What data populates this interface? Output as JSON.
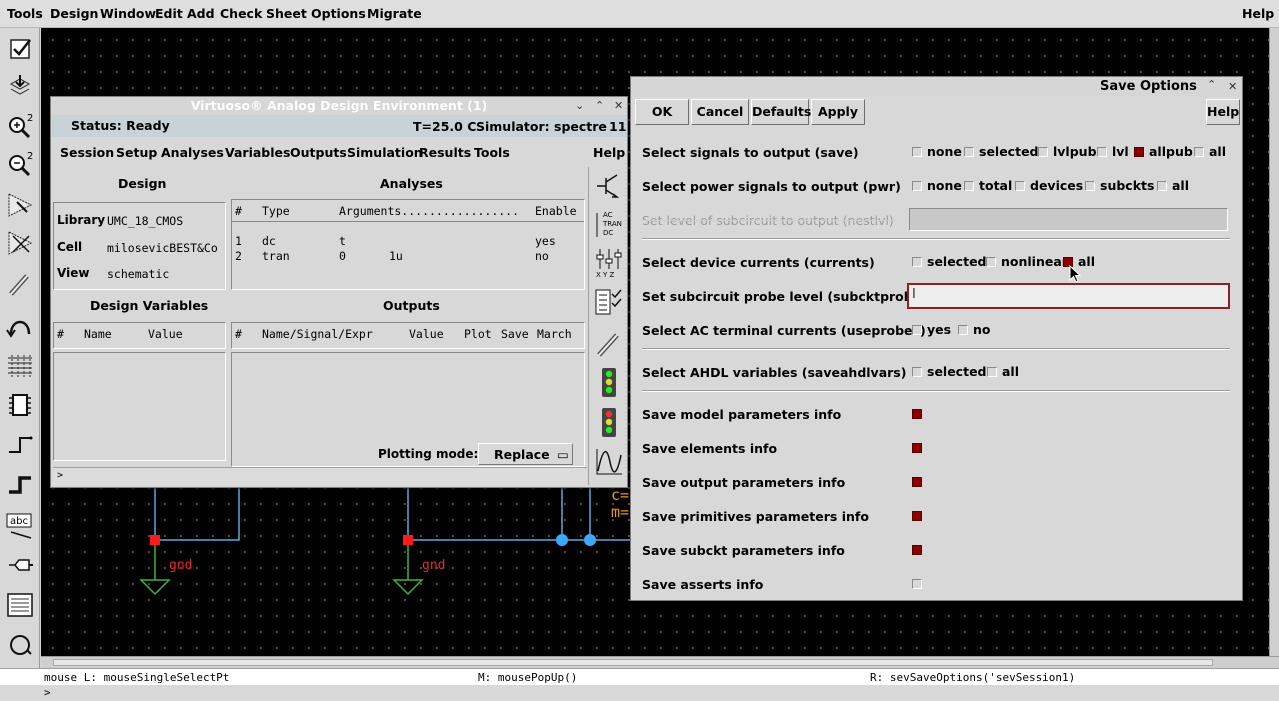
{
  "menubar": {
    "items": [
      "Tools",
      "Design",
      "Window",
      "Edit",
      "Add",
      "Check",
      "Sheet",
      "Options",
      "Migrate"
    ],
    "help": "Help"
  },
  "toolbar_icons": [
    "check-and-save-icon",
    "save-icon",
    "zoom-in-icon",
    "zoom-out-icon",
    "stretch-icon",
    "copy-icon",
    "delete-icon",
    "undo-icon",
    "property-icon",
    "instance-icon",
    "wire-narrow-icon",
    "wire-wide-icon",
    "label-icon",
    "pin-icon",
    "cmd-options-icon",
    "repeat-icon"
  ],
  "toolbar_label_abc": "abc",
  "schematic": {
    "gnd_label": "gnd",
    "partial_text_1": "c=",
    "partial_text_2": "m="
  },
  "ade": {
    "title": "Virtuoso® Analog Design Environment (1)",
    "status": "Status: Ready",
    "temperature": "T=25.0 C",
    "simulator": "Simulator: spectre",
    "counter": "11",
    "menus": [
      "Session",
      "Setup",
      "Analyses",
      "Variables",
      "Outputs",
      "Simulation",
      "Results",
      "Tools"
    ],
    "help": "Help",
    "design": {
      "heading": "Design",
      "library_label": "Library",
      "library_value": "UMC_18_CMOS",
      "cell_label": "Cell",
      "cell_value": "milosevicBEST&Co",
      "view_label": "View",
      "view_value": "schematic"
    },
    "analyses": {
      "heading": "Analyses",
      "columns": [
        "#",
        "Type",
        "Arguments.................",
        "Enable"
      ],
      "rows": [
        {
          "num": "1",
          "type": "dc",
          "arg1": "t",
          "arg2": "",
          "enable": "yes"
        },
        {
          "num": "2",
          "type": "tran",
          "arg1": "0",
          "arg2": "1u",
          "enable": "no"
        }
      ]
    },
    "design_variables": {
      "heading": "Design Variables",
      "columns": [
        "#",
        "Name",
        "Value"
      ]
    },
    "outputs": {
      "heading": "Outputs",
      "columns": [
        "#",
        "Name/Signal/Expr",
        "Value",
        "Plot",
        "Save",
        "March"
      ]
    },
    "plotting_mode_label": "Plotting mode:",
    "plotting_mode_value": "Replace",
    "prompt": ">",
    "side_tool_labels": {
      "ac": "AC",
      "tran": "TRAN",
      "dc": "DC",
      "xyz": "X Y Z"
    }
  },
  "save_options": {
    "title": "Save Options",
    "buttons": {
      "ok": "OK",
      "cancel": "Cancel",
      "defaults": "Defaults",
      "apply": "Apply",
      "help": "Help"
    },
    "save": {
      "label": "Select signals to output (save)",
      "options": [
        {
          "label": "none",
          "checked": false
        },
        {
          "label": "selected",
          "checked": false
        },
        {
          "label": "lvlpub",
          "checked": false
        },
        {
          "label": "lvl",
          "checked": false
        },
        {
          "label": "allpub",
          "checked": true
        },
        {
          "label": "all",
          "checked": false
        }
      ]
    },
    "pwr": {
      "label": "Select power signals to output (pwr)",
      "options": [
        {
          "label": "none",
          "checked": false
        },
        {
          "label": "total",
          "checked": false
        },
        {
          "label": "devices",
          "checked": false
        },
        {
          "label": "subckts",
          "checked": false
        },
        {
          "label": "all",
          "checked": false
        }
      ]
    },
    "nestlvl": {
      "label": "Set level of subcircuit to output (nestlvl)",
      "value": ""
    },
    "currents": {
      "label": "Select device currents (currents)",
      "options": [
        {
          "label": "selected",
          "checked": false
        },
        {
          "label": "nonlinear",
          "checked": false
        },
        {
          "label": "all",
          "checked": true
        }
      ]
    },
    "subcktprobelvl": {
      "label": "Set subcircuit probe level (subcktprobelvl)",
      "value": ""
    },
    "useprobes": {
      "label": "Select AC terminal currents (useprobes)",
      "options": [
        {
          "label": "yes",
          "checked": false
        },
        {
          "label": "no",
          "checked": false
        }
      ]
    },
    "saveahdlvars": {
      "label": "Select AHDL variables (saveahdlvars)",
      "options": [
        {
          "label": "selected",
          "checked": false
        },
        {
          "label": "all",
          "checked": false
        }
      ]
    },
    "info": [
      {
        "label": "Save model parameters info",
        "checked": true
      },
      {
        "label": "Save elements info",
        "checked": true
      },
      {
        "label": "Save output parameters info",
        "checked": true
      },
      {
        "label": "Save primitives parameters info",
        "checked": true
      },
      {
        "label": "Save subckt parameters info",
        "checked": true
      },
      {
        "label": "Save asserts info",
        "checked": false
      }
    ],
    "colors": {
      "checked": "#8b0000",
      "focus_border": "#8b2020"
    }
  },
  "statusbar": {
    "left": "mouse L: mouseSingleSelectPt",
    "middle": "M: mousePopUp()",
    "right": "R: sevSaveOptions('sevSession1)"
  },
  "command_prompt": ">"
}
